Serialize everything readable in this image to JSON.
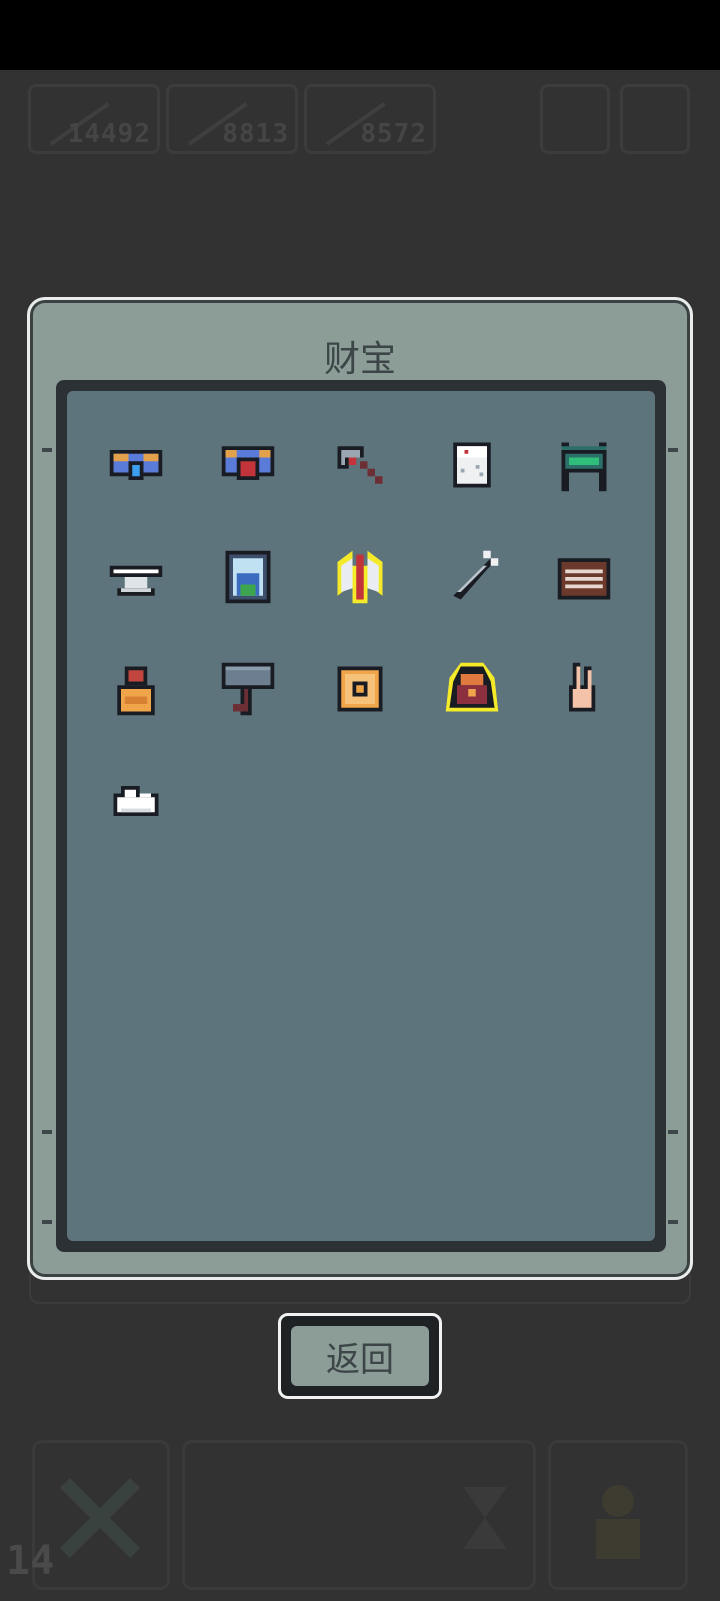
{
  "hud": {
    "stats": [
      "14492",
      "8813",
      "8572"
    ],
    "level": "14"
  },
  "dialog": {
    "title": "财宝",
    "items": [
      {
        "name": "blue-orb-goggles-icon"
      },
      {
        "name": "red-orb-goggles-icon"
      },
      {
        "name": "pickaxe-icon"
      },
      {
        "name": "dice-icon"
      },
      {
        "name": "green-shop-stand-icon"
      },
      {
        "name": "anvil-icon"
      },
      {
        "name": "portrait-frame-icon"
      },
      {
        "name": "double-axe-icon",
        "highlighted": true
      },
      {
        "name": "sword-icon"
      },
      {
        "name": "abacus-icon"
      },
      {
        "name": "clay-pot-icon"
      },
      {
        "name": "war-hammer-icon"
      },
      {
        "name": "ornate-ring-icon"
      },
      {
        "name": "treasure-chest-icon",
        "highlighted": true
      },
      {
        "name": "peace-hand-icon"
      },
      {
        "name": "cloud-icon"
      }
    ]
  },
  "back_label": "返回",
  "colors": {
    "background": "#323232",
    "dialog": "#8c9c96",
    "panel": "#5e747c",
    "highlight": "#f4ea2a"
  }
}
